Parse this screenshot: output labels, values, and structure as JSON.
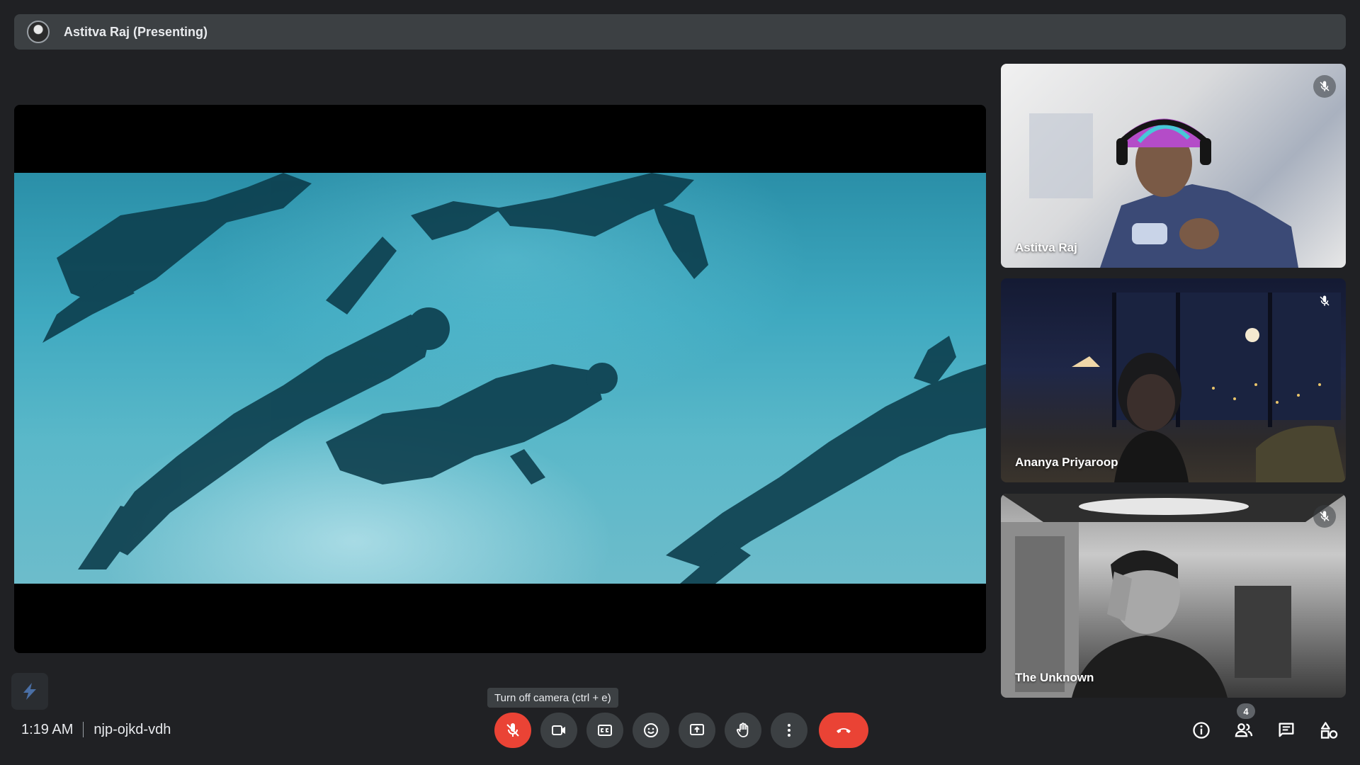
{
  "presenter": {
    "name": "Astitva Raj (Presenting)"
  },
  "participants": [
    {
      "name": "Astitva Raj",
      "muted": true
    },
    {
      "name": "Ananya Priyaroop",
      "muted": true
    },
    {
      "name": "The Unknown",
      "muted": true
    }
  ],
  "meeting": {
    "time": "1:19 AM",
    "code": "njp-ojkd-vdh"
  },
  "tooltip": {
    "text": "Turn off camera (ctrl + e)"
  },
  "controls": [
    "microphone-off",
    "camera",
    "captions",
    "emoji",
    "present",
    "raise-hand",
    "more-options",
    "leave-call"
  ],
  "right_controls": {
    "people_count": "4"
  },
  "colors": {
    "background": "#202124",
    "surface": "#3c4043",
    "danger": "#ea4335",
    "text": "#e8eaed"
  }
}
